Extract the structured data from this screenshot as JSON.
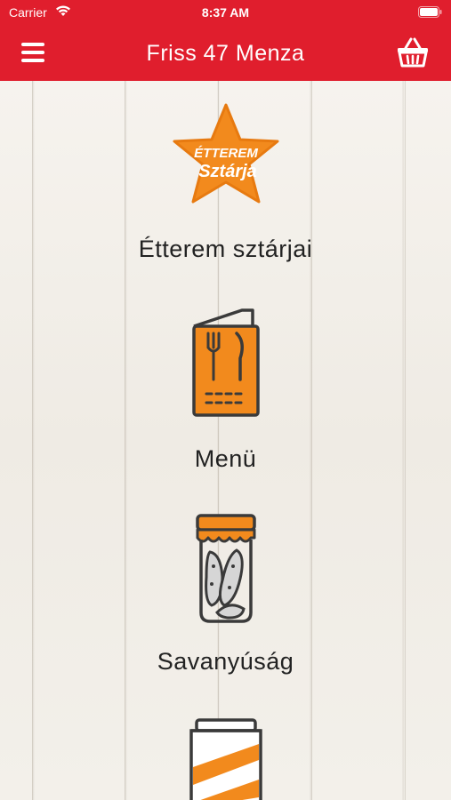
{
  "status": {
    "carrier": "Carrier",
    "time": "8:37 AM"
  },
  "nav": {
    "title": "Friss 47 Menza",
    "menu_icon": "hamburger-icon",
    "cart_icon": "basket-icon"
  },
  "colors": {
    "brand_red": "#e01e2d",
    "accent_orange": "#f28a1d",
    "icon_dark": "#3a3a3a"
  },
  "menu": {
    "items": [
      {
        "label": "Étterem sztárjai",
        "icon": "star-badge-icon",
        "badge_line1": "ÉTTEREM",
        "badge_line2": "Sztárja"
      },
      {
        "label": "Menü",
        "icon": "menu-card-icon"
      },
      {
        "label": "Savanyúság",
        "icon": "pickle-jar-icon"
      },
      {
        "label": "",
        "icon": "can-icon"
      }
    ]
  }
}
